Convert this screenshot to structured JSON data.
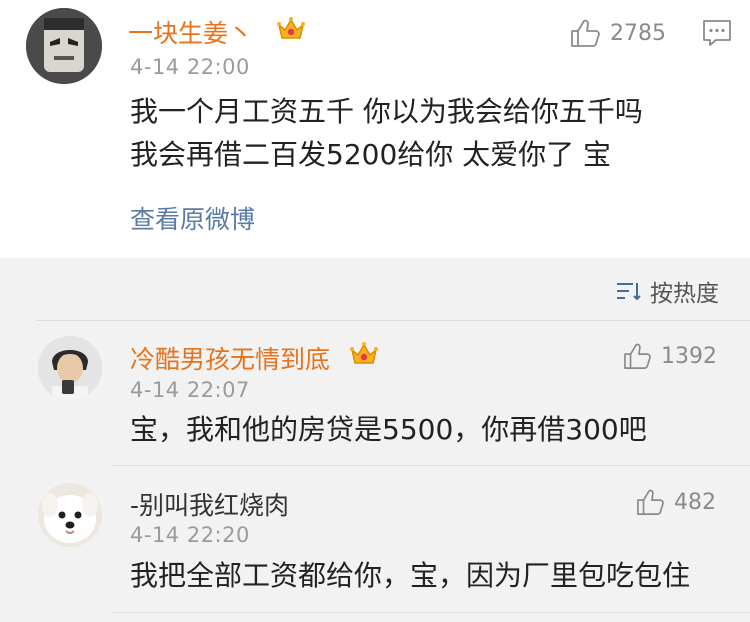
{
  "main_post": {
    "user_name": "一块生姜丶",
    "time": "4-14 22:00",
    "like_count": "2785",
    "content_line1": "我一个月工资五千 你以为我会给你五千吗",
    "content_line2": "我会再借二百发5200给你 太爱你了 宝",
    "view_original_link": "查看原微博",
    "icons": {
      "like": "thumbs-up-icon",
      "comment": "comment-icon",
      "badge": "crown-badge-icon"
    }
  },
  "sort": {
    "label": "按热度",
    "icon": "sort-icon"
  },
  "replies": [
    {
      "user_name": "冷酷男孩无情到底",
      "time": "4-14 22:07",
      "like_count": "1392",
      "content": "宝，我和他的房贷是5500，你再借300吧",
      "name_color": "#e8731a"
    },
    {
      "user_name": "-别叫我红烧肉",
      "time": "4-14 22:20",
      "like_count": "482",
      "content": "我把全部工资都给你，宝，因为厂里包吃包住",
      "name_color": "#333333"
    }
  ],
  "colors": {
    "accent_orange": "#e8731a",
    "link_blue": "#5a7ba7",
    "background": "#f2f2f2"
  }
}
